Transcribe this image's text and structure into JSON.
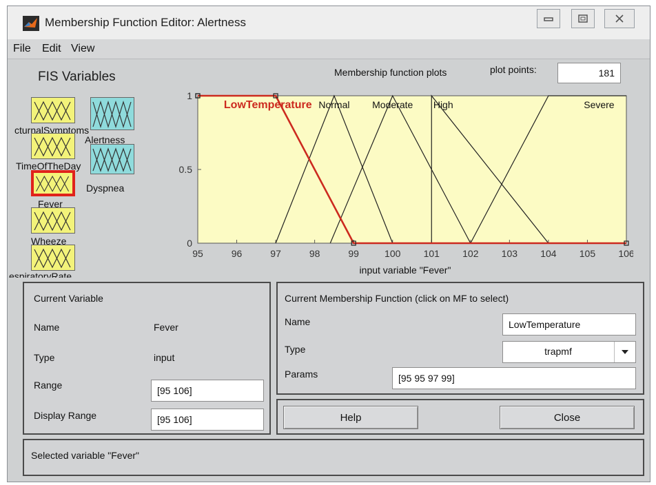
{
  "window": {
    "title": "Membership Function Editor: Alertness",
    "icon": "matlab-logo-icon",
    "controls": [
      "minimize-icon",
      "maximize-icon",
      "close-icon"
    ]
  },
  "menu": [
    "File",
    "Edit",
    "View"
  ],
  "fis_variables": {
    "title": "FIS Variables",
    "inputs": [
      "NocturnalSymptoms",
      "TimeOfTheDay",
      "Fever",
      "Wheeze",
      "RespiratoryRate"
    ],
    "visible_labels": {
      "nocturnal": "cturnalSymptoms",
      "timeofday": "TimeOfTheDay",
      "fever": "Fever",
      "wheeze": "Wheeze",
      "respiratory": "espiratoryRate"
    },
    "outputs": [
      "Alertness",
      "Dyspnea"
    ],
    "selected": "Fever"
  },
  "plot": {
    "header": "Membership function plots",
    "plot_points_label": "plot points:",
    "plot_points_value": "181"
  },
  "chart_data": {
    "type": "line",
    "xlabel": "input variable \"Fever\"",
    "xlim": [
      95,
      106
    ],
    "ylim": [
      0,
      1
    ],
    "x_ticks": [
      95,
      96,
      97,
      98,
      99,
      100,
      101,
      102,
      103,
      104,
      105,
      106
    ],
    "y_ticks": [
      0,
      0.5,
      1
    ],
    "background": "#fcfbc4",
    "selected_color": "#cc2a1f",
    "series": [
      {
        "name": "LowTemperature",
        "x": [
          95,
          95,
          97,
          99,
          106
        ],
        "y": [
          1,
          1,
          1,
          0,
          0
        ],
        "selected": true
      },
      {
        "name": "Normal",
        "x": [
          97,
          98.5,
          100
        ],
        "y": [
          0,
          1,
          0
        ],
        "selected": false
      },
      {
        "name": "Moderate",
        "x": [
          98.4,
          100,
          102
        ],
        "y": [
          0,
          1,
          0
        ],
        "selected": false
      },
      {
        "name": "High",
        "x": [
          101,
          101,
          104
        ],
        "y": [
          0,
          1,
          0
        ],
        "selected": false
      },
      {
        "name": "Severe",
        "x": [
          102,
          104,
          106
        ],
        "y": [
          0,
          1,
          1
        ],
        "selected": false
      }
    ],
    "label_positions": {
      "LowTemperature": 96.8,
      "Normal": 98.5,
      "Moderate": 100,
      "High": 101.3,
      "Severe": 105.3
    }
  },
  "current_variable": {
    "title": "Current Variable",
    "name_label": "Name",
    "name_value": "Fever",
    "type_label": "Type",
    "type_value": "input",
    "range_label": "Range",
    "range_value": "[95 106]",
    "display_range_label": "Display Range",
    "display_range_value": "[95 106]"
  },
  "current_mf": {
    "title": "Current Membership Function (click on MF to select)",
    "name_label": "Name",
    "name_value": "LowTemperature",
    "type_label": "Type",
    "type_value": "trapmf",
    "params_label": "Params",
    "params_value": "[95 95 97 99]"
  },
  "buttons": {
    "help": "Help",
    "close": "Close"
  },
  "status": "Selected variable \"Fever\""
}
